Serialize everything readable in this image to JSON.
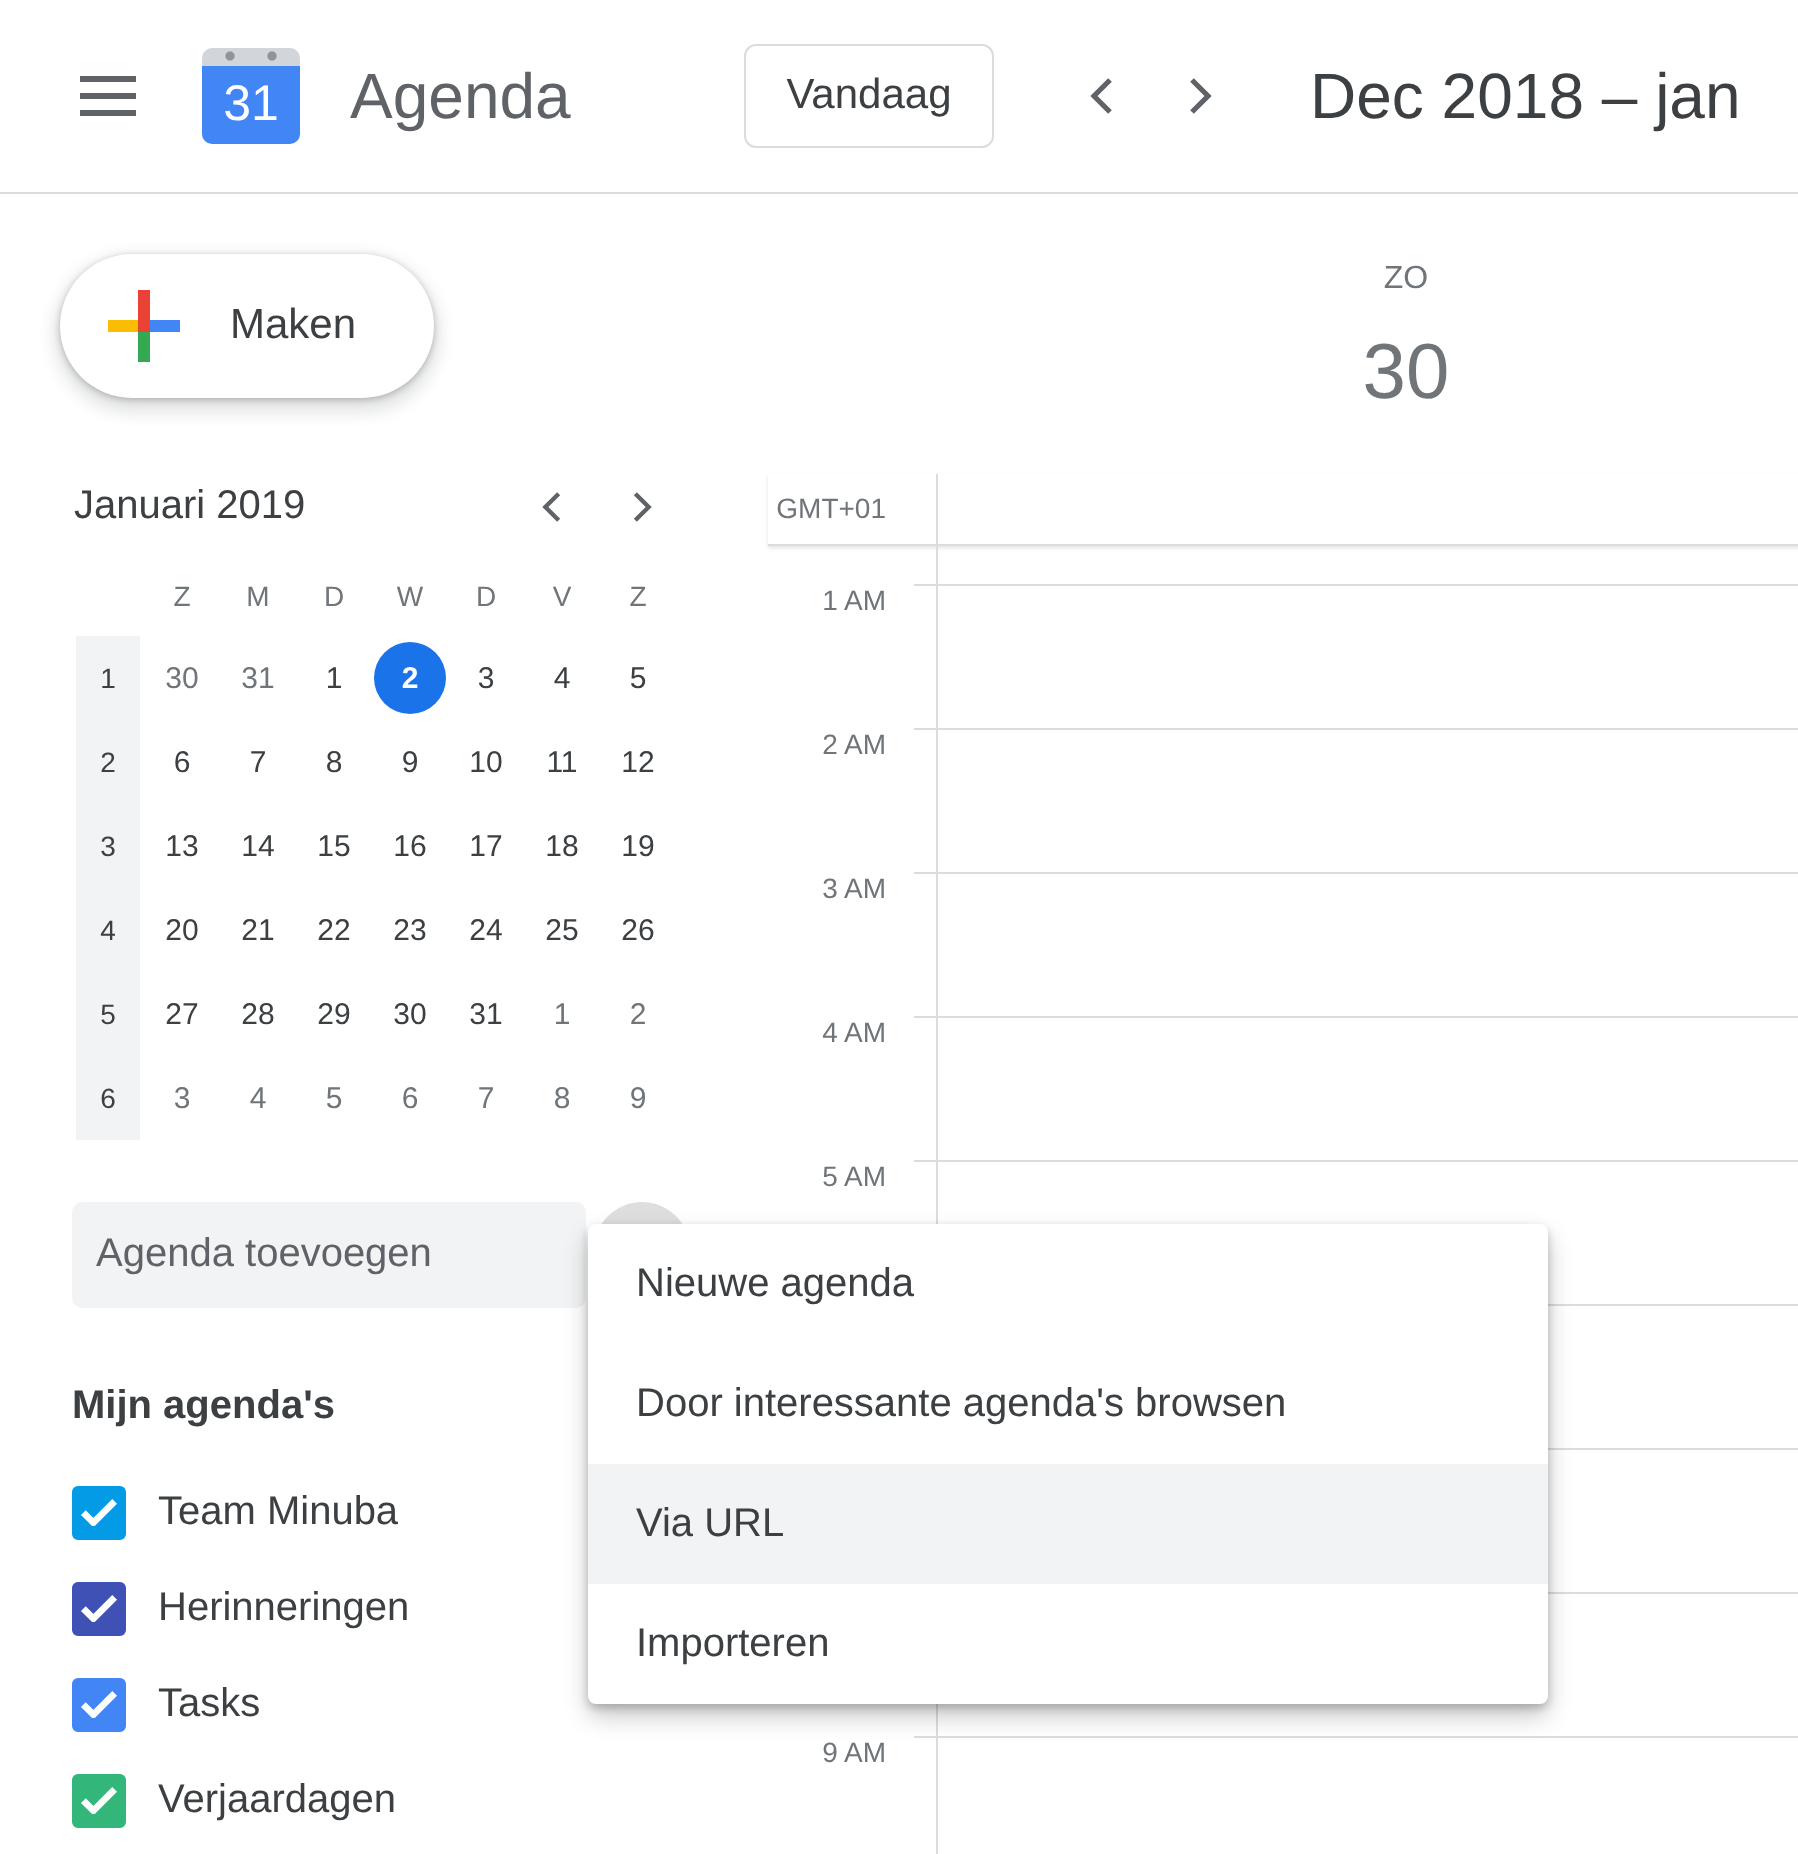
{
  "header": {
    "logo_day": "31",
    "title": "Agenda",
    "today_button": "Vandaag",
    "date_range": "Dec 2018 – jan"
  },
  "sidebar": {
    "create_button": "Maken",
    "mini_calendar": {
      "title": "Januari 2019",
      "weekdays": [
        "Z",
        "M",
        "D",
        "W",
        "D",
        "V",
        "Z"
      ],
      "weeks": [
        {
          "number": "1",
          "days": [
            {
              "label": "30",
              "in_month": false,
              "today": false
            },
            {
              "label": "31",
              "in_month": false,
              "today": false
            },
            {
              "label": "1",
              "in_month": true,
              "today": false
            },
            {
              "label": "2",
              "in_month": true,
              "today": true
            },
            {
              "label": "3",
              "in_month": true,
              "today": false
            },
            {
              "label": "4",
              "in_month": true,
              "today": false
            },
            {
              "label": "5",
              "in_month": true,
              "today": false
            }
          ]
        },
        {
          "number": "2",
          "days": [
            {
              "label": "6",
              "in_month": true,
              "today": false
            },
            {
              "label": "7",
              "in_month": true,
              "today": false
            },
            {
              "label": "8",
              "in_month": true,
              "today": false
            },
            {
              "label": "9",
              "in_month": true,
              "today": false
            },
            {
              "label": "10",
              "in_month": true,
              "today": false
            },
            {
              "label": "11",
              "in_month": true,
              "today": false
            },
            {
              "label": "12",
              "in_month": true,
              "today": false
            }
          ]
        },
        {
          "number": "3",
          "days": [
            {
              "label": "13",
              "in_month": true,
              "today": false
            },
            {
              "label": "14",
              "in_month": true,
              "today": false
            },
            {
              "label": "15",
              "in_month": true,
              "today": false
            },
            {
              "label": "16",
              "in_month": true,
              "today": false
            },
            {
              "label": "17",
              "in_month": true,
              "today": false
            },
            {
              "label": "18",
              "in_month": true,
              "today": false
            },
            {
              "label": "19",
              "in_month": true,
              "today": false
            }
          ]
        },
        {
          "number": "4",
          "days": [
            {
              "label": "20",
              "in_month": true,
              "today": false
            },
            {
              "label": "21",
              "in_month": true,
              "today": false
            },
            {
              "label": "22",
              "in_month": true,
              "today": false
            },
            {
              "label": "23",
              "in_month": true,
              "today": false
            },
            {
              "label": "24",
              "in_month": true,
              "today": false
            },
            {
              "label": "25",
              "in_month": true,
              "today": false
            },
            {
              "label": "26",
              "in_month": true,
              "today": false
            }
          ]
        },
        {
          "number": "5",
          "days": [
            {
              "label": "27",
              "in_month": true,
              "today": false
            },
            {
              "label": "28",
              "in_month": true,
              "today": false
            },
            {
              "label": "29",
              "in_month": true,
              "today": false
            },
            {
              "label": "30",
              "in_month": true,
              "today": false
            },
            {
              "label": "31",
              "in_month": true,
              "today": false
            },
            {
              "label": "1",
              "in_month": false,
              "today": false
            },
            {
              "label": "2",
              "in_month": false,
              "today": false
            }
          ]
        },
        {
          "number": "6",
          "days": [
            {
              "label": "3",
              "in_month": false,
              "today": false
            },
            {
              "label": "4",
              "in_month": false,
              "today": false
            },
            {
              "label": "5",
              "in_month": false,
              "today": false
            },
            {
              "label": "6",
              "in_month": false,
              "today": false
            },
            {
              "label": "7",
              "in_month": false,
              "today": false
            },
            {
              "label": "8",
              "in_month": false,
              "today": false
            },
            {
              "label": "9",
              "in_month": false,
              "today": false
            }
          ]
        }
      ]
    },
    "add_calendar": {
      "placeholder": "Agenda toevoegen"
    },
    "my_calendars": {
      "title": "Mijn agenda's",
      "items": [
        {
          "name": "Team Minuba",
          "checked": true,
          "color": "#039be5"
        },
        {
          "name": "Herinneringen",
          "checked": true,
          "color": "#3f51b5"
        },
        {
          "name": "Tasks",
          "checked": true,
          "color": "#4285f4"
        },
        {
          "name": "Verjaardagen",
          "checked": true,
          "color": "#33b679"
        }
      ]
    }
  },
  "day_view": {
    "day_name": "ZO",
    "day_number": "30",
    "timezone": "GMT+01",
    "hours_above_menu": [
      "1 AM",
      "2 AM",
      "3 AM",
      "4 AM",
      "5 AM"
    ],
    "hours_below_menu": [
      "9 AM"
    ]
  },
  "menu": {
    "items": [
      {
        "label": "Nieuwe agenda",
        "selected": false
      },
      {
        "label": "Door interessante agenda's browsen",
        "selected": false
      },
      {
        "label": "Via URL",
        "selected": true
      },
      {
        "label": "Importeren",
        "selected": false
      }
    ]
  }
}
